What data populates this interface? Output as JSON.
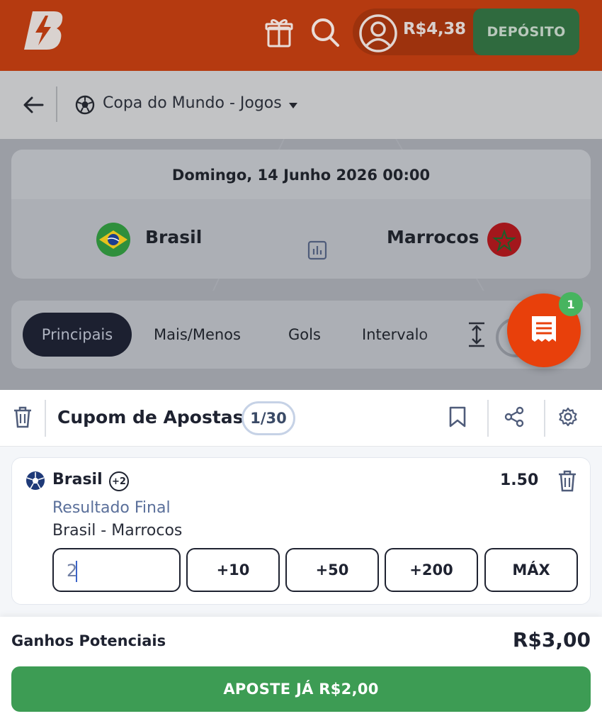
{
  "header": {
    "balance": "R$4,38",
    "deposit_label": "DEPÓSITO",
    "icons": [
      "brand-logo",
      "gift-icon",
      "search-icon",
      "user-icon"
    ]
  },
  "nav": {
    "competition": "Copa do Mundo - Jogos",
    "icons": [
      "back-arrow-icon",
      "soccer-ball-icon",
      "caret-down-icon"
    ]
  },
  "match": {
    "date": "Domingo, 14 Junho 2026 00:00",
    "home": "Brasil",
    "away": "Marrocos"
  },
  "market_tabs": [
    {
      "label": "Principais",
      "active": true
    },
    {
      "label": "Mais/Menos",
      "active": false
    },
    {
      "label": "Gols",
      "active": false
    },
    {
      "label": "Intervalo",
      "active": false
    }
  ],
  "betslip_badge": "1",
  "slip": {
    "title": "Cupom de Apostas",
    "count": "1/30",
    "icons": [
      "trash-icon",
      "bookmark-icon",
      "share-icon",
      "settings-icon"
    ]
  },
  "bet": {
    "selection": "Brasil",
    "extra": "+2",
    "odds": "1.50",
    "market": "Resultado Final",
    "event": "Brasil - Marrocos",
    "stake": "2",
    "quick_stakes": [
      "+10",
      "+50",
      "+200",
      "MÁX"
    ]
  },
  "footer": {
    "potential_label": "Ganhos Potenciais",
    "potential_value": "R$3,00",
    "place_bet_label": "APOSTE JÁ R$2,00"
  },
  "colors": {
    "brand": "#e8400b",
    "header_bg": "#b53a10",
    "deposit": "#2f6a3e",
    "place_bet": "#3d9c54",
    "active_tab": "#1c2030",
    "badge": "#47b45f"
  }
}
